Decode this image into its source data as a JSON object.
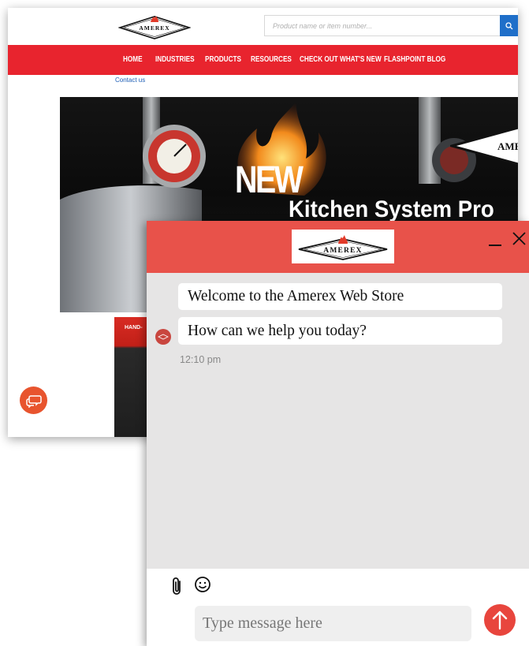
{
  "site": {
    "brand": "AMEREX",
    "search": {
      "placeholder": "Product name or item number..."
    },
    "nav": [
      "HOME",
      "INDUSTRIES",
      "PRODUCTS",
      "RESOURCES",
      "CHECK OUT WHAT'S NEW",
      "FLASHPOINT BLOG"
    ],
    "contact_link": "Contact us",
    "hero": {
      "headline": "NEW",
      "subtitle": "Kitchen System Pro"
    },
    "promo": {
      "label": "HAND-"
    }
  },
  "chat": {
    "brand": "AMEREX",
    "messages": [
      {
        "text": "Welcome to the Amerex Web Store"
      },
      {
        "text": "How can we help you today?"
      }
    ],
    "timestamp": "12:10 pm",
    "input_placeholder": "Type message here"
  },
  "colors": {
    "nav_red": "#e8242e",
    "chat_header": "#e8524a",
    "send_button": "#e8453d",
    "search_button": "#1f6fc9",
    "launcher": "#e8542e"
  },
  "icons": [
    "search-icon",
    "chat-bubbles-icon",
    "minimize-icon",
    "close-icon",
    "paperclip-icon",
    "smiley-icon",
    "arrow-up-icon",
    "flame-icon"
  ]
}
